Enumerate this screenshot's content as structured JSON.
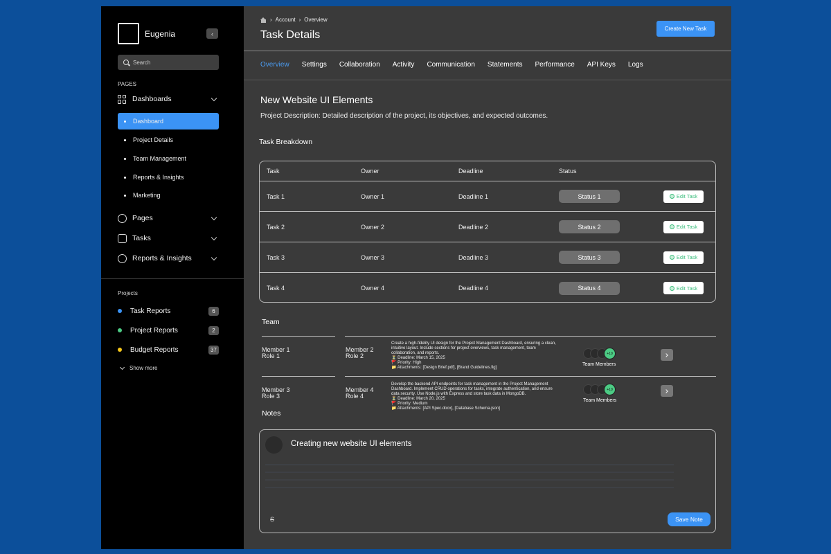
{
  "sidebar": {
    "brand": "Eugenia",
    "search_placeholder": "Search",
    "pages_label": "PAGES",
    "groups": [
      {
        "label": "Dashboards",
        "icon": "grid-icon"
      },
      {
        "label": "Pages",
        "icon": "document-icon"
      },
      {
        "label": "Tasks",
        "icon": "chart-icon"
      },
      {
        "label": "Reports & Insights",
        "icon": "globe-icon"
      }
    ],
    "dashboard_items": [
      "Dashboard",
      "Project Details",
      "Team Management",
      "Reports & Insights",
      "Marketing"
    ],
    "projects_label": "Projects",
    "projects": [
      {
        "label": "Task Reports",
        "count": "6",
        "color": "#3b93f5"
      },
      {
        "label": "Project Reports",
        "count": "2",
        "color": "#4ccb84"
      },
      {
        "label": "Budget Reports",
        "count": "37",
        "color": "#f5c518"
      }
    ],
    "show_more": "Show more"
  },
  "header": {
    "breadcrumb": [
      "Account",
      "Overview"
    ],
    "title": "Task Details",
    "create_button": "Create New Task"
  },
  "tabs": [
    "Overview",
    "Settings",
    "Collaboration",
    "Activity",
    "Communication",
    "Statements",
    "Performance",
    "API Keys",
    "Logs"
  ],
  "project": {
    "title": "New Website UI Elements",
    "description": "Project Description: Detailed description of the project, its objectives, and expected outcomes."
  },
  "breakdown": {
    "title": "Task Breakdown",
    "columns": [
      "Task",
      "Owner",
      "Deadline",
      "Status"
    ],
    "rows": [
      {
        "task": "Task 1",
        "owner": "Owner 1",
        "deadline": "Deadline 1",
        "status": "Status 1",
        "action": "Edit Task"
      },
      {
        "task": "Task 2",
        "owner": "Owner 2",
        "deadline": "Deadline 2",
        "status": "Status 2",
        "action": "Edit Task"
      },
      {
        "task": "Task 3",
        "owner": "Owner 3",
        "deadline": "Deadline 3",
        "status": "Status 3",
        "action": "Edit Task"
      },
      {
        "task": "Task 4",
        "owner": "Owner 4",
        "deadline": "Deadline 4",
        "status": "Status 4",
        "action": "Edit Task"
      }
    ]
  },
  "team": {
    "title": "Team",
    "rows": [
      {
        "m1": "Member 1",
        "r1": "Role 1",
        "m2": "Member 2",
        "r2": "Role 2",
        "desc": [
          "Create a high-fidelity UI design for the Project Management Dashboard, ensuring a clean,",
          "intuitive layout. Include sections for project overviews, task management, team",
          "collaboration, and reports.",
          "⏳ Deadline: March 15, 2025",
          "🚩 Priority: High",
          "📁 Attachments: [Design Brief.pdf], [Brand Guidelines.fig]"
        ],
        "more": "+10",
        "label": "Team Members"
      },
      {
        "m1": "Member 3",
        "r1": "Role 3",
        "m2": "Member 4",
        "r2": "Role 4",
        "desc": [
          "Develop the backend API endpoints for task management in the Project Management",
          "Dashboard. Implement CRUD operations for tasks, integrate authentication, and ensure",
          "data security. Use Node.js with Express and store task data in MongoDB.",
          "⏳ Deadline: March 20, 2025",
          "🚩 Priority: Medium",
          "📁 Attachments: [API Spec.docx], [Database Schema.json]"
        ],
        "more": "+10",
        "label": "Team Members"
      }
    ]
  },
  "notes": {
    "title": "Notes",
    "note_title": "Creating new website UI elements",
    "save_button": "Save Note"
  }
}
